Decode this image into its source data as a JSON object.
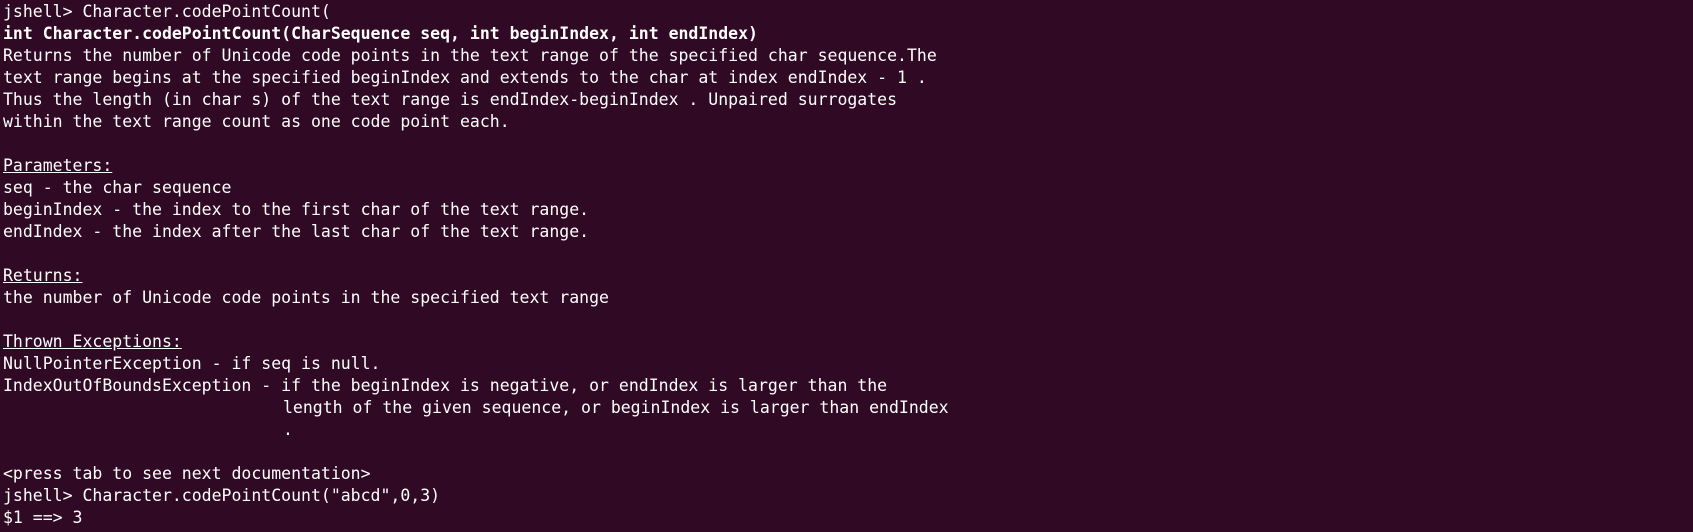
{
  "terminal": {
    "lines": [
      {
        "text": "jshell> Character.codePointCount(",
        "style": "normal"
      },
      {
        "text": "int Character.codePointCount(CharSequence seq, int beginIndex, int endIndex)",
        "style": "bold"
      },
      {
        "text": "Returns the number of Unicode code points in the text range of the specified char sequence.The",
        "style": "normal"
      },
      {
        "text": "text range begins at the specified beginIndex and extends to the char at index endIndex - 1 .",
        "style": "normal"
      },
      {
        "text": "Thus the length (in char s) of the text range is endIndex-beginIndex . Unpaired surrogates",
        "style": "normal"
      },
      {
        "text": "within the text range count as one code point each.",
        "style": "normal"
      },
      {
        "text": "",
        "style": "normal"
      },
      {
        "text": "Parameters:",
        "style": "underline"
      },
      {
        "text": "seq - the char sequence",
        "style": "normal"
      },
      {
        "text": "beginIndex - the index to the first char of the text range.",
        "style": "normal"
      },
      {
        "text": "endIndex - the index after the last char of the text range.",
        "style": "normal"
      },
      {
        "text": "",
        "style": "normal"
      },
      {
        "text": "Returns:",
        "style": "underline"
      },
      {
        "text": "the number of Unicode code points in the specified text range",
        "style": "normal"
      },
      {
        "text": "",
        "style": "normal"
      },
      {
        "text": "Thrown Exceptions:",
        "style": "underline"
      },
      {
        "text": "NullPointerException - if seq is null.",
        "style": "normal"
      },
      {
        "text": "IndexOutOfBoundsException - if the beginIndex is negative, or endIndex is larger than the",
        "style": "normal"
      },
      {
        "text": "length of the given sequence, or beginIndex is larger than endIndex",
        "style": "indent"
      },
      {
        "text": ".",
        "style": "indent"
      },
      {
        "text": "",
        "style": "normal"
      },
      {
        "text": "<press tab to see next documentation>",
        "style": "normal"
      },
      {
        "text": "jshell> Character.codePointCount(\"abcd\",0,3)",
        "style": "normal"
      },
      {
        "text": "$1 ==> 3",
        "style": "normal"
      }
    ]
  },
  "colors": {
    "background": "#300a24",
    "foreground": "#ffffff"
  }
}
